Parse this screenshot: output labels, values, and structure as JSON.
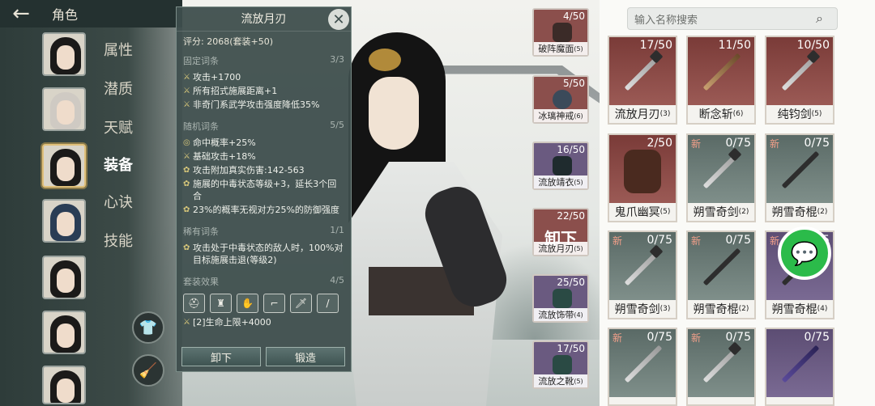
{
  "header": {
    "back_icon": "arrow-left-icon",
    "title": "角色"
  },
  "side_menu": [
    "属性",
    "潜质",
    "天赋",
    "装备",
    "心诀",
    "技能"
  ],
  "active_menu": "装备",
  "tooltip": {
    "name": "流放月刃",
    "score": "评分: 2068(套装+50)",
    "fixed": {
      "label": "固定词条",
      "count": "3/3",
      "lines": [
        "攻击+1700",
        "所有招式施展距离+1",
        "非奇门系武学攻击强度降低35%"
      ]
    },
    "random": {
      "label": "随机词条",
      "count": "5/5",
      "lines": [
        "命中概率+25%",
        "基础攻击+18%",
        "攻击附加真实伤害:142-563",
        "施展的中毒状态等级+3，延长3个回合",
        "23%的概率无视对方25%的防御强度"
      ]
    },
    "rare": {
      "label": "稀有词条",
      "count": "1/1",
      "lines": [
        "攻击处于中毒状态的敌人时，100%对目标施展击退(等级2)"
      ]
    },
    "set": {
      "label": "套装效果",
      "count": "4/5",
      "icons": [
        "helmet-icon",
        "armor-icon",
        "glove-icon",
        "boot-icon",
        "sword-icon",
        "blade-icon"
      ],
      "line": "[2]生命上限+4000"
    },
    "btn_unequip": "卸下",
    "btn_forge": "锻造"
  },
  "equip_slots": [
    {
      "count": "4/50",
      "label": "破阵魔面",
      "lvl": "(5)",
      "color": "red"
    },
    {
      "count": "5/50",
      "label": "冰璃神戒",
      "lvl": "(6)",
      "color": "red"
    },
    {
      "count": "16/50",
      "label": "流放靖衣",
      "lvl": "(5)",
      "color": "purple"
    },
    {
      "count": "22/50",
      "label": "流放月刃",
      "lvl": "(5)",
      "color": "red",
      "unequip": "卸下"
    },
    {
      "count": "25/50",
      "label": "流放饰带",
      "lvl": "(4)",
      "color": "purple"
    },
    {
      "count": "17/50",
      "label": "流放之靴",
      "lvl": "(5)",
      "color": "purple"
    }
  ],
  "search": {
    "placeholder": "输入名称搜索"
  },
  "inventory": [
    {
      "count": "17/50",
      "label": "流放月刃",
      "lvl": "(3)",
      "style": "red",
      "new": ""
    },
    {
      "count": "11/50",
      "label": "断念斩",
      "lvl": "(6)",
      "style": "red",
      "new": ""
    },
    {
      "count": "10/50",
      "label": "纯钧剑",
      "lvl": "(5)",
      "style": "red",
      "new": ""
    },
    {
      "count": "2/50",
      "label": "鬼爪幽冥",
      "lvl": "(5)",
      "style": "red",
      "new": ""
    },
    {
      "count": "0/75",
      "label": "朔雪奇剑",
      "lvl": "(2)",
      "style": "grey",
      "new": "新"
    },
    {
      "count": "0/75",
      "label": "朔雪奇棍",
      "lvl": "(2)",
      "style": "grey",
      "new": "新"
    },
    {
      "count": "0/75",
      "label": "朔雪奇剑",
      "lvl": "(3)",
      "style": "grey",
      "new": "新"
    },
    {
      "count": "0/75",
      "label": "朔雪奇棍",
      "lvl": "(2)",
      "style": "grey",
      "new": "新"
    },
    {
      "count": "0/75",
      "label": "朔雪奇棍",
      "lvl": "(4)",
      "style": "purple",
      "new": "新"
    },
    {
      "count": "0/75",
      "label": "",
      "lvl": "",
      "style": "grey",
      "new": "新"
    },
    {
      "count": "0/75",
      "label": "",
      "lvl": "",
      "style": "grey",
      "new": "新"
    },
    {
      "count": "0/75",
      "label": "",
      "lvl": "",
      "style": "purple",
      "new": ""
    }
  ]
}
